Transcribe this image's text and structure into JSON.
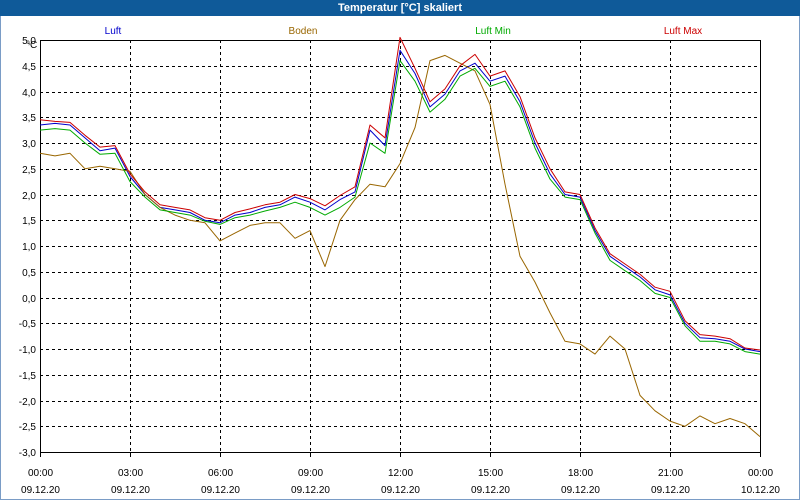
{
  "chart_data": {
    "type": "line",
    "title": "Temperatur [°C] skaliert",
    "ylabel": "°C",
    "ylim": [
      -3.0,
      5.0
    ],
    "yticks": [
      "5,0",
      "4,5",
      "4,0",
      "3,5",
      "3,0",
      "2,5",
      "2,0",
      "1,5",
      "1,0",
      "0,5",
      "0,0",
      "-0,5",
      "-1,0",
      "-1,5",
      "-2,0",
      "-2,5",
      "-3,0"
    ],
    "xlim": [
      0,
      24
    ],
    "xticks": [
      {
        "time": "00:00",
        "date": "09.12.20"
      },
      {
        "time": "03:00",
        "date": "09.12.20"
      },
      {
        "time": "06:00",
        "date": "09.12.20"
      },
      {
        "time": "09:00",
        "date": "09.12.20"
      },
      {
        "time": "12:00",
        "date": "09.12.20"
      },
      {
        "time": "15:00",
        "date": "09.12.20"
      },
      {
        "time": "18:00",
        "date": "09.12.20"
      },
      {
        "time": "21:00",
        "date": "09.12.20"
      },
      {
        "time": "00:00",
        "date": "10.12.20"
      }
    ],
    "grid": true,
    "legend_position": "top",
    "series": [
      {
        "name": "Luft",
        "color": "#0000cc",
        "x": [
          0,
          0.5,
          1,
          1.5,
          2,
          2.5,
          3,
          3.5,
          4,
          4.5,
          5,
          5.5,
          6,
          6.5,
          7,
          7.5,
          8,
          8.5,
          9,
          9.5,
          10,
          10.5,
          11,
          11.5,
          12,
          12.5,
          13,
          13.5,
          14,
          14.5,
          15,
          15.5,
          16,
          16.5,
          17,
          17.5,
          18,
          18.5,
          19,
          19.5,
          20,
          20.5,
          21,
          21.5,
          22,
          22.5,
          23,
          23.5,
          24
        ],
        "y": [
          3.35,
          3.38,
          3.35,
          3.1,
          2.85,
          2.9,
          2.35,
          2.0,
          1.75,
          1.7,
          1.65,
          1.5,
          1.45,
          1.6,
          1.65,
          1.75,
          1.8,
          1.95,
          1.85,
          1.7,
          1.9,
          2.05,
          3.25,
          2.95,
          4.8,
          4.35,
          3.7,
          3.95,
          4.4,
          4.55,
          4.2,
          4.3,
          3.8,
          3.0,
          2.4,
          2.0,
          1.95,
          1.3,
          0.8,
          0.6,
          0.4,
          0.15,
          0.05,
          -0.5,
          -0.78,
          -0.8,
          -0.85,
          -1.0,
          -1.05
        ]
      },
      {
        "name": "Boden",
        "color": "#996600",
        "x": [
          0,
          0.5,
          1,
          1.5,
          2,
          2.5,
          3,
          3.5,
          4,
          4.5,
          5,
          5.5,
          6,
          6.5,
          7,
          7.5,
          8,
          8.5,
          9,
          9.5,
          10,
          10.5,
          11,
          11.5,
          12,
          12.5,
          13,
          13.5,
          14,
          14.5,
          15,
          15.5,
          16,
          16.5,
          17,
          17.5,
          18,
          18.5,
          19,
          19.5,
          20,
          20.5,
          21,
          21.5,
          22,
          22.5,
          23,
          23.5,
          24
        ],
        "y": [
          2.8,
          2.75,
          2.8,
          2.5,
          2.55,
          2.5,
          2.45,
          2.0,
          1.75,
          1.6,
          1.5,
          1.45,
          1.1,
          1.25,
          1.4,
          1.45,
          1.45,
          1.15,
          1.3,
          0.6,
          1.5,
          1.9,
          2.2,
          2.15,
          2.6,
          3.3,
          4.6,
          4.7,
          4.55,
          4.4,
          3.75,
          2.2,
          0.8,
          0.3,
          -0.3,
          -0.85,
          -0.9,
          -1.1,
          -0.75,
          -1.0,
          -1.9,
          -2.2,
          -2.4,
          -2.5,
          -2.3,
          -2.45,
          -2.35,
          -2.45,
          -2.7
        ]
      },
      {
        "name": "Luft Min",
        "color": "#00aa00",
        "x": [
          0,
          0.5,
          1,
          1.5,
          2,
          2.5,
          3,
          3.5,
          4,
          4.5,
          5,
          5.5,
          6,
          6.5,
          7,
          7.5,
          8,
          8.5,
          9,
          9.5,
          10,
          10.5,
          11,
          11.5,
          12,
          12.5,
          13,
          13.5,
          14,
          14.5,
          15,
          15.5,
          16,
          16.5,
          17,
          17.5,
          18,
          18.5,
          19,
          19.5,
          20,
          20.5,
          21,
          21.5,
          22,
          22.5,
          23,
          23.5,
          24
        ],
        "y": [
          3.25,
          3.28,
          3.25,
          3.0,
          2.78,
          2.8,
          2.25,
          1.95,
          1.7,
          1.65,
          1.6,
          1.48,
          1.42,
          1.55,
          1.6,
          1.68,
          1.75,
          1.85,
          1.75,
          1.6,
          1.75,
          1.95,
          3.0,
          2.8,
          4.6,
          4.2,
          3.6,
          3.85,
          4.3,
          4.45,
          4.1,
          4.2,
          3.7,
          2.9,
          2.3,
          1.95,
          1.9,
          1.25,
          0.72,
          0.52,
          0.33,
          0.08,
          0.0,
          -0.55,
          -0.85,
          -0.85,
          -0.9,
          -1.05,
          -1.1
        ]
      },
      {
        "name": "Luft Max",
        "color": "#cc0000",
        "x": [
          0,
          0.5,
          1,
          1.5,
          2,
          2.5,
          3,
          3.5,
          4,
          4.5,
          5,
          5.5,
          6,
          6.5,
          7,
          7.5,
          8,
          8.5,
          9,
          9.5,
          10,
          10.5,
          11,
          11.5,
          12,
          12.5,
          13,
          13.5,
          14,
          14.5,
          15,
          15.5,
          16,
          16.5,
          17,
          17.5,
          18,
          18.5,
          19,
          19.5,
          20,
          20.5,
          21,
          21.5,
          22,
          22.5,
          23,
          23.5,
          24
        ],
        "y": [
          3.45,
          3.42,
          3.4,
          3.15,
          2.92,
          2.95,
          2.4,
          2.05,
          1.8,
          1.75,
          1.7,
          1.55,
          1.5,
          1.65,
          1.72,
          1.8,
          1.85,
          2.0,
          1.92,
          1.78,
          1.98,
          2.15,
          3.35,
          3.1,
          5.05,
          4.45,
          3.8,
          4.05,
          4.5,
          4.72,
          4.3,
          4.4,
          3.9,
          3.1,
          2.5,
          2.05,
          2.0,
          1.35,
          0.85,
          0.65,
          0.45,
          0.2,
          0.12,
          -0.45,
          -0.72,
          -0.75,
          -0.8,
          -0.98,
          -1.02
        ]
      }
    ]
  }
}
